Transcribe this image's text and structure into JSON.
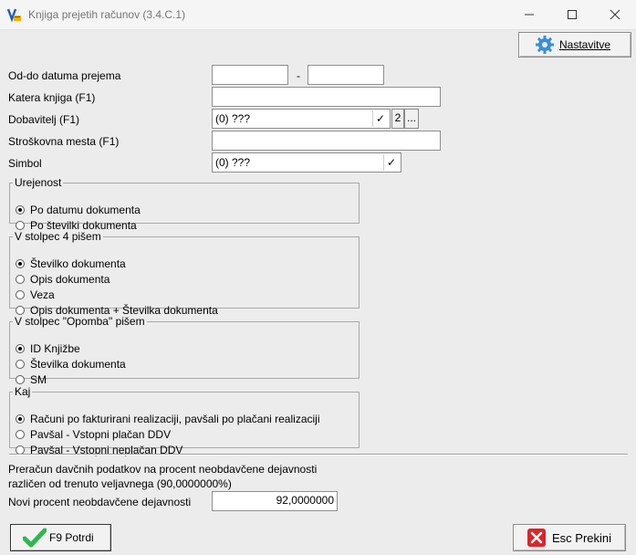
{
  "window": {
    "title": "Knjiga prejetih računov  (3.4.C.1)"
  },
  "toolbar": {
    "settings_label": "Nastavitve"
  },
  "form": {
    "date_range": {
      "label": "Od-do datuma prejema",
      "from": "",
      "to": "",
      "separator": "-"
    },
    "book": {
      "label": "Katera knjiga (F1)",
      "value": ""
    },
    "supplier": {
      "label": "Dobavitelj (F1)",
      "value": "(0) ???",
      "check": "✓",
      "count_btn": "2",
      "more_btn": "..."
    },
    "cost_centers": {
      "label": "Stroškovna mesta (F1)",
      "value": ""
    },
    "symbol": {
      "label": "Simbol",
      "value": "(0) ???",
      "check": "✓"
    }
  },
  "groups": {
    "ordering": {
      "legend": "Urejenost",
      "options": [
        "Po datumu dokumenta",
        "Po številki dokumenta"
      ],
      "selected": 0
    },
    "column4": {
      "legend": "V stolpec 4 pišem",
      "options": [
        "Številko dokumenta",
        "Opis dokumenta",
        "Veza",
        "Opis dokumenta + Številka dokumenta"
      ],
      "selected": 0
    },
    "note_column": {
      "legend": "V stolpec \"Opomba\" pišem",
      "options": [
        "ID Knjižbe",
        "Številka dokumenta",
        "SM"
      ],
      "selected": 0
    },
    "what": {
      "legend": "Kaj",
      "options": [
        "Računi po fakturirani realizaciji, pavšali po plačani realizaciji",
        "Pavšal - Vstopni plačan DDV",
        "Pavšal - Vstopni neplačan DDV"
      ],
      "selected": 0
    }
  },
  "recalc": {
    "line1": "Preračun davčnih podatkov na procent neobdavčene dejavnosti",
    "line2": "različen od trenuto veljavnega (90,0000000%)",
    "new_label": "Novi procent neobdavčene dejavnosti",
    "new_value": "92,0000000"
  },
  "footer": {
    "confirm_label": "F9 Potrdi",
    "cancel_label": "Esc Prekini"
  },
  "colors": {
    "confirm_check": "#2db84d",
    "cancel_red": "#d9262b",
    "gear_blue": "#3a8fd8"
  }
}
